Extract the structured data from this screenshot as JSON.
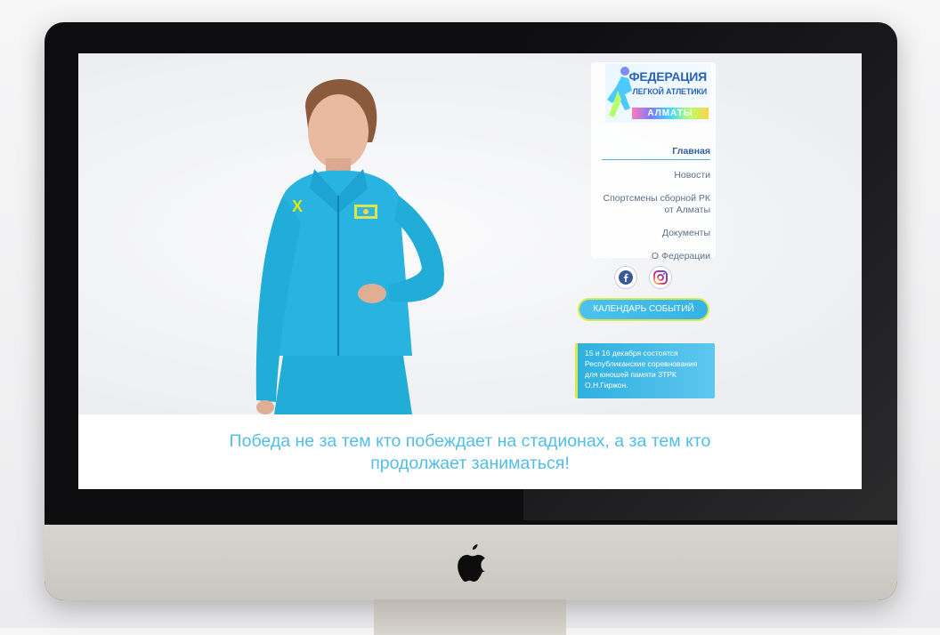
{
  "nav": {
    "items": [
      {
        "label": "Главная",
        "active": true
      },
      {
        "label": "Новости",
        "active": false
      },
      {
        "label": "Спортсмены сборной РК от Алматы",
        "active": false
      },
      {
        "label": "Документы",
        "active": false
      },
      {
        "label": "О Федерации",
        "active": false
      }
    ]
  },
  "logo": {
    "line1": "ФЕДЕРАЦИЯ",
    "line2": "ЛЕГКОЙ АТЛЕТИКИ",
    "city": "АЛМАТЫ"
  },
  "socials": [
    {
      "icon": "facebook-icon"
    },
    {
      "icon": "instagram-icon"
    }
  ],
  "calendar_button": {
    "label": "КАЛЕНДАРЬ СОБЫТИЙ"
  },
  "notice": {
    "text": "15 и 16 декабря состоятся Республиканские соревнования для юношей памяти ЗТРК О.Н.Гиржон."
  },
  "quote": {
    "text": "Победа не за тем кто побеждает на стадионах, а за тем кто продолжает заниматься!"
  },
  "colors": {
    "accent": "#3fbbe8",
    "highlight": "#d9ea4a",
    "nav_text": "#5b6f86",
    "quote_text": "#53bde7",
    "monitor_bezel": "#0e0e10",
    "monitor_chin": "#d0ccc6"
  }
}
